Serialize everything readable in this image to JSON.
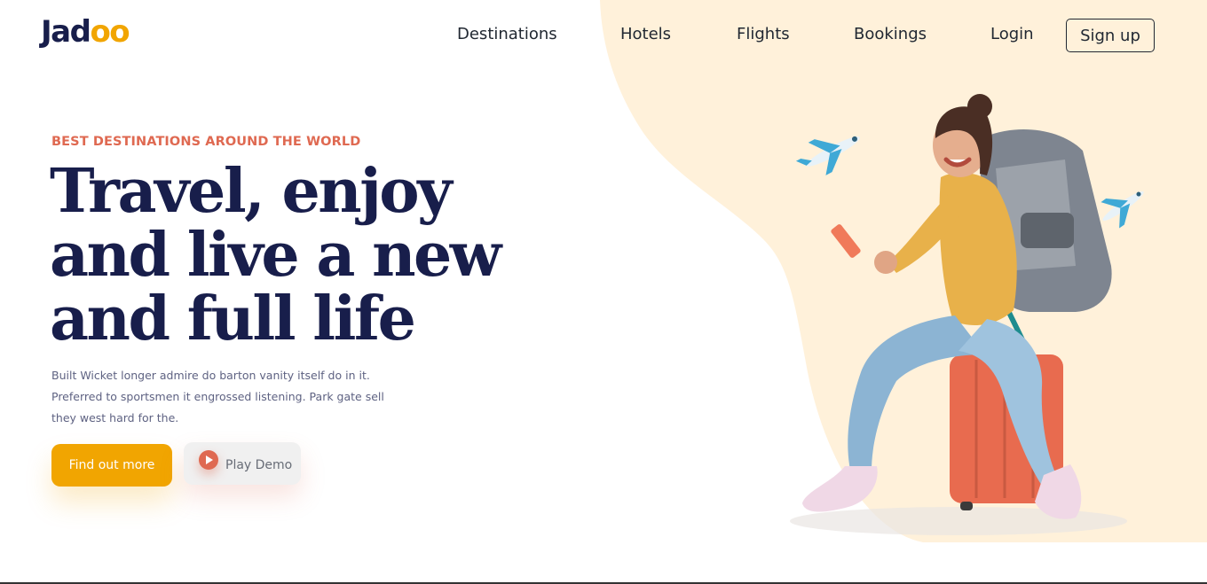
{
  "brand": {
    "logo_main": "Jad",
    "logo_accent": "oo"
  },
  "nav": {
    "items": [
      {
        "label": "Destinations"
      },
      {
        "label": "Hotels"
      },
      {
        "label": "Flights"
      },
      {
        "label": "Bookings"
      },
      {
        "label": "Login"
      }
    ],
    "signup_label": "Sign up"
  },
  "hero": {
    "eyebrow": "BEST DESTINATIONS AROUND THE WORLD",
    "headline": "Travel, enjoy and live a new and full life",
    "description": "Built Wicket longer admire do barton vanity itself do in it. Preferred to sportsmen it engrossed listening. Park gate sell they west hard for the.",
    "primary_cta": "Find out more",
    "secondary_cta": "Play Demo",
    "illustration": "traveler-with-backpack-on-suitcase"
  },
  "colors": {
    "accent_orange": "#F1A501",
    "accent_coral": "#DF6951",
    "heading_navy": "#181E4B",
    "body_text": "#5E6282",
    "blob_cream": "#FFF1DA"
  },
  "icons": [
    "airplane-icon",
    "play-icon"
  ]
}
